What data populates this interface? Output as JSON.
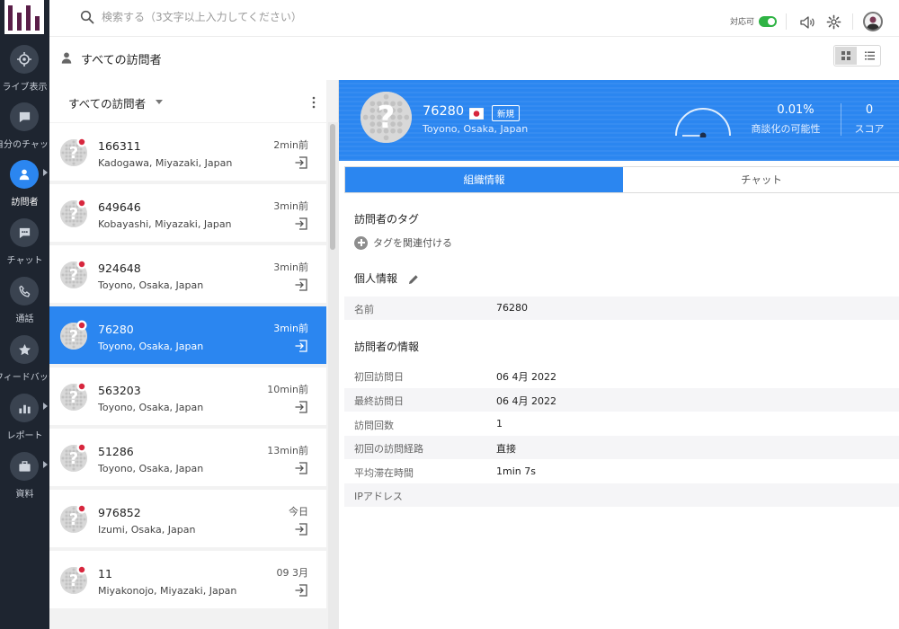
{
  "search": {
    "placeholder": "検索する（3文字以上入力してください）"
  },
  "topbar": {
    "availability_label": "対応可",
    "availability_on": true
  },
  "sidebar": {
    "items": [
      {
        "label": "ライブ表示",
        "icon": "target-icon",
        "active": false,
        "has_caret": false
      },
      {
        "label": "自分のチャット",
        "icon": "chat-bubble-icon",
        "active": false,
        "has_caret": false
      },
      {
        "label": "訪問者",
        "icon": "user-icon",
        "active": true,
        "has_caret": true
      },
      {
        "label": "チャット",
        "icon": "chat-dots-icon",
        "active": false,
        "has_caret": false
      },
      {
        "label": "通話",
        "icon": "phone-icon",
        "active": false,
        "has_caret": false
      },
      {
        "label": "フィードバック",
        "icon": "star-icon",
        "active": false,
        "has_caret": false
      },
      {
        "label": "レポート",
        "icon": "bar-chart-icon",
        "active": false,
        "has_caret": true
      },
      {
        "label": "資料",
        "icon": "briefcase-icon",
        "active": false,
        "has_caret": true
      }
    ]
  },
  "subheader": {
    "title": "すべての訪問者"
  },
  "list": {
    "filter_label": "すべての訪問者",
    "visitors": [
      {
        "id": "166311",
        "location": "Kadogawa, Miyazaki, Japan",
        "time": "2min前",
        "selected": false
      },
      {
        "id": "649646",
        "location": "Kobayashi, Miyazaki, Japan",
        "time": "3min前",
        "selected": false
      },
      {
        "id": "924648",
        "location": "Toyono, Osaka, Japan",
        "time": "3min前",
        "selected": false
      },
      {
        "id": "76280",
        "location": "Toyono, Osaka, Japan",
        "time": "3min前",
        "selected": true
      },
      {
        "id": "563203",
        "location": "Toyono, Osaka, Japan",
        "time": "10min前",
        "selected": false
      },
      {
        "id": "51286",
        "location": "Toyono, Osaka, Japan",
        "time": "13min前",
        "selected": false
      },
      {
        "id": "976852",
        "location": "Izumi, Osaka, Japan",
        "time": "今日",
        "selected": false
      },
      {
        "id": "11",
        "location": "Miyakonojo, Miyazaki, Japan",
        "time": "09 3月",
        "selected": false
      }
    ]
  },
  "detail": {
    "visitor_id": "76280",
    "badge": "新規",
    "location": "Toyono, Osaka, Japan",
    "probability_value": "0.01%",
    "probability_fraction": 0.0001,
    "probability_label": "商談化の可能性",
    "score_value": "0",
    "score_label": "スコア",
    "tabs": [
      {
        "label": "組織情報",
        "active": true
      },
      {
        "label": "チャット",
        "active": false
      }
    ],
    "tags_title": "訪問者のタグ",
    "add_tag_label": "タグを関連付ける",
    "personal_title": "個人情報",
    "personal_rows": [
      {
        "label": "名前",
        "value": "76280"
      }
    ],
    "visitor_info_title": "訪問者の情報",
    "visitor_rows": [
      {
        "label": "初回訪問日",
        "value": "06 4月 2022"
      },
      {
        "label": "最終訪問日",
        "value": "06 4月 2022"
      },
      {
        "label": "訪問回数",
        "value": "1"
      },
      {
        "label": "初回の訪問経路",
        "value": "直接"
      },
      {
        "label": "平均滞在時間",
        "value": "1min 7s"
      },
      {
        "label": "IPアドレス",
        "value": ""
      }
    ]
  },
  "colors": {
    "accent": "#2b86f0",
    "rail": "#1e2530",
    "toggle_on": "#2fb344",
    "flag_red": "#d7263d"
  }
}
